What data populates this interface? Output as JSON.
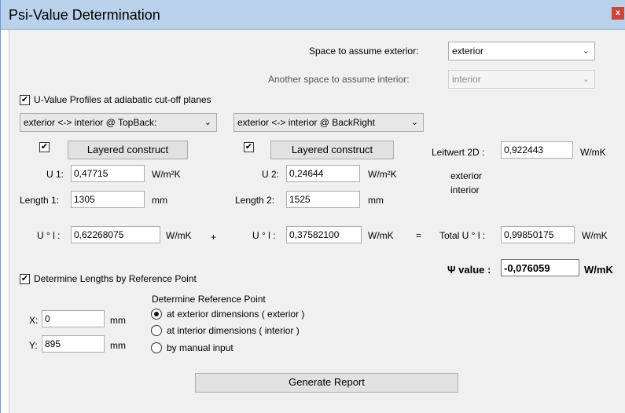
{
  "window": {
    "title": "Psi-Value Determination",
    "close_label": "x"
  },
  "exterior": {
    "label": "Space to assume exterior:",
    "value": "exterior"
  },
  "interior": {
    "label": "Another space to assume interior:",
    "value": "interior"
  },
  "profiles": {
    "checkbox_label": "U-Value Profiles at adiabatic cut-off planes",
    "checked": true,
    "left_dropdown": "exterior <-> interior @ TopBack:",
    "right_dropdown": "exterior <-> interior @ BackRight"
  },
  "left": {
    "construct_button": "Layered construct",
    "u_label": "U 1:",
    "u_value": "0,47715",
    "u_unit": "W/m²K",
    "length_label": "Length 1:",
    "length_value": "1305",
    "length_unit": "mm",
    "ul_label": "U ° l :",
    "ul_value": "0,62268075",
    "ul_unit": "W/mK"
  },
  "right": {
    "construct_button": "Layered construct",
    "u_label": "U 2:",
    "u_value": "0,24644",
    "u_unit": "W/m²K",
    "length_label": "Length 2:",
    "length_value": "1525",
    "length_unit": "mm",
    "ul_label": "U ° l :",
    "ul_value": "0,37582100",
    "ul_unit": "W/mK"
  },
  "operators": {
    "plus": "+",
    "equals": "="
  },
  "leitwert": {
    "label": "Leitwert 2D :",
    "value": "0,922443",
    "unit": "W/mK",
    "space1": "exterior",
    "space2": "interior"
  },
  "total": {
    "label": "Total U ° l :",
    "value": "0,99850175",
    "unit": "W/mK"
  },
  "psi": {
    "label": "Ψ value :",
    "value": "-0,076059",
    "unit": "W/mK"
  },
  "reference": {
    "checkbox_label": "Determine Lengths by Reference Point",
    "checked": true,
    "x_label": "X:",
    "x_value": "0",
    "x_unit": "mm",
    "y_label": "Y:",
    "y_value": "895",
    "y_unit": "mm",
    "group_label": "Determine Reference Point",
    "options": [
      {
        "label": "at exterior dimensions ( exterior )",
        "selected": true
      },
      {
        "label": "at interior dimensions ( interior )",
        "selected": false
      },
      {
        "label": "by manual input",
        "selected": false
      }
    ]
  },
  "generate_button": "Generate Report"
}
